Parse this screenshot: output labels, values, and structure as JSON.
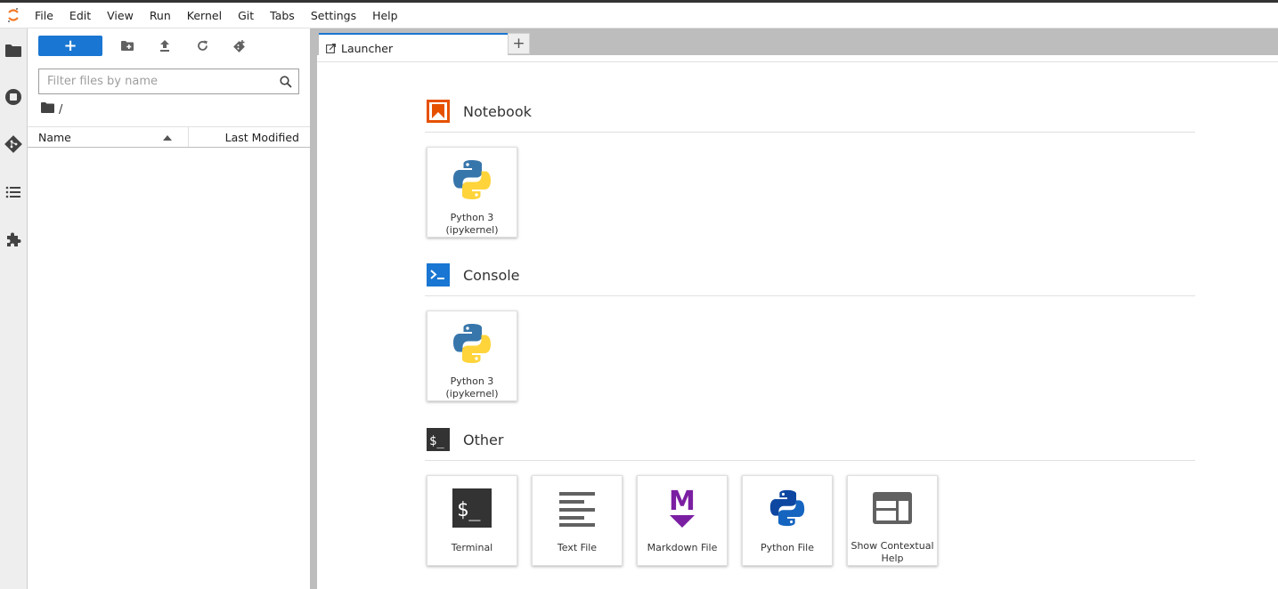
{
  "menubar": {
    "items": [
      "File",
      "Edit",
      "View",
      "Run",
      "Kernel",
      "Git",
      "Tabs",
      "Settings",
      "Help"
    ]
  },
  "activitybar": {
    "icons": [
      "folder-icon",
      "running-icon",
      "git-icon",
      "toc-icon",
      "extension-icon"
    ]
  },
  "filebrowser": {
    "new_label": "+",
    "filter_placeholder": "Filter files by name",
    "filter_value": "",
    "breadcrumb": "/",
    "columns": {
      "name": "Name",
      "last_modified": "Last Modified"
    }
  },
  "tabs": [
    {
      "label": "Launcher"
    }
  ],
  "add_tab_label": "+",
  "launcher": {
    "sections": {
      "notebook": {
        "title": "Notebook",
        "items": [
          {
            "label_line1": "Python 3",
            "label_line2": "(ipykernel)"
          }
        ]
      },
      "console": {
        "title": "Console",
        "items": [
          {
            "label_line1": "Python 3",
            "label_line2": "(ipykernel)"
          }
        ]
      },
      "other": {
        "title": "Other",
        "items": [
          {
            "label": "Terminal"
          },
          {
            "label": "Text File"
          },
          {
            "label": "Markdown File"
          },
          {
            "label": "Python File"
          },
          {
            "label_line1": "Show Contextual",
            "label_line2": "Help"
          }
        ]
      }
    }
  },
  "colors": {
    "accent": "#1976d2",
    "notebook_orange": "#e65100",
    "console_blue": "#1976d2",
    "other_dark": "#333333",
    "markdown_purple": "#7b1fa2",
    "python_blue": "#0d47a1"
  }
}
